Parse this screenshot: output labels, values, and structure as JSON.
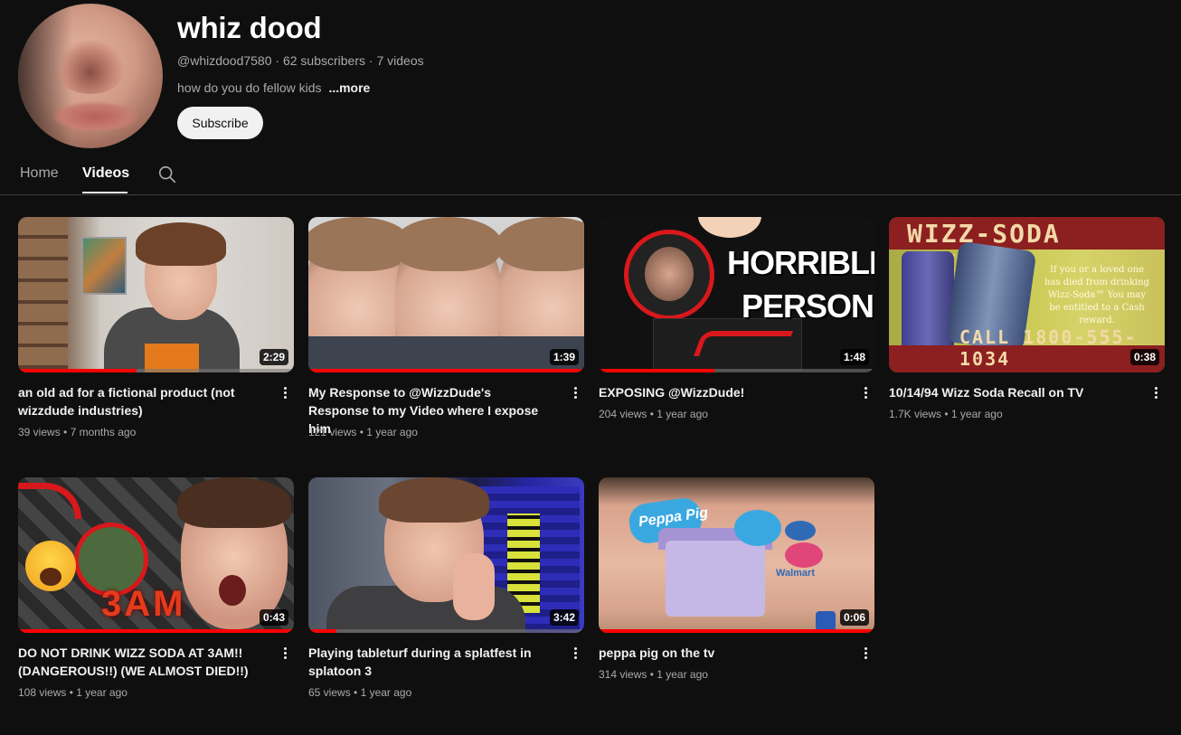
{
  "channel": {
    "name": "whiz dood",
    "handle": "@whizdood7580",
    "subscribers": "62 subscribers",
    "video_count": "7 videos",
    "description": "how do you do fellow kids",
    "more_label": "...more",
    "subscribe_label": "Subscribe"
  },
  "tabs": [
    {
      "label": "Home",
      "active": false
    },
    {
      "label": "Videos",
      "active": true
    }
  ],
  "videos": [
    {
      "title": "an old ad for a fictional product (not wizzdude industries)",
      "views": "39 views",
      "age": "7 months ago",
      "duration": "2:29",
      "progress": 0.43
    },
    {
      "title": "My Response to @WizzDude's Response to my Video where I expose him",
      "views": "121 views",
      "age": "1 year ago",
      "duration": "1:39",
      "progress": 1.0
    },
    {
      "title": "EXPOSING @WizzDude!",
      "views": "204 views",
      "age": "1 year ago",
      "duration": "1:48",
      "progress": 0.42,
      "thumb_text": [
        "HORRIBLE",
        "PERSON"
      ]
    },
    {
      "title": "10/14/94 Wizz Soda Recall on TV",
      "views": "1.7K views",
      "age": "1 year ago",
      "duration": "0:38",
      "progress": 0.0,
      "thumb_text": [
        "WIZZ-SODA RECALL",
        "CALL 1800-555-1034",
        "If you or a loved one has died from drinking Wizz-Soda™ You may be entitled to a Cash reward."
      ]
    },
    {
      "title": "DO NOT DRINK WIZZ SODA AT 3AM!! (DANGEROUS!!) (WE ALMOST DIED!!)",
      "views": "108 views",
      "age": "1 year ago",
      "duration": "0:43",
      "progress": 1.0,
      "thumb_text": [
        "3AM"
      ]
    },
    {
      "title": "Playing tableturf during a splatfest in splatoon 3",
      "views": "65 views",
      "age": "1 year ago",
      "duration": "3:42",
      "progress": 0.1
    },
    {
      "title": "peppa pig on the tv",
      "views": "314 views",
      "age": "1 year ago",
      "duration": "0:06",
      "progress": 1.0,
      "thumb_text": [
        "Peppa Pig",
        "Walmart"
      ]
    }
  ],
  "icons": {
    "search": "search-icon",
    "menu": "more-vert-icon"
  },
  "colors": {
    "background": "#0f0f0f",
    "progress": "#ff0000",
    "subscribe_bg": "#f1f1f1"
  }
}
